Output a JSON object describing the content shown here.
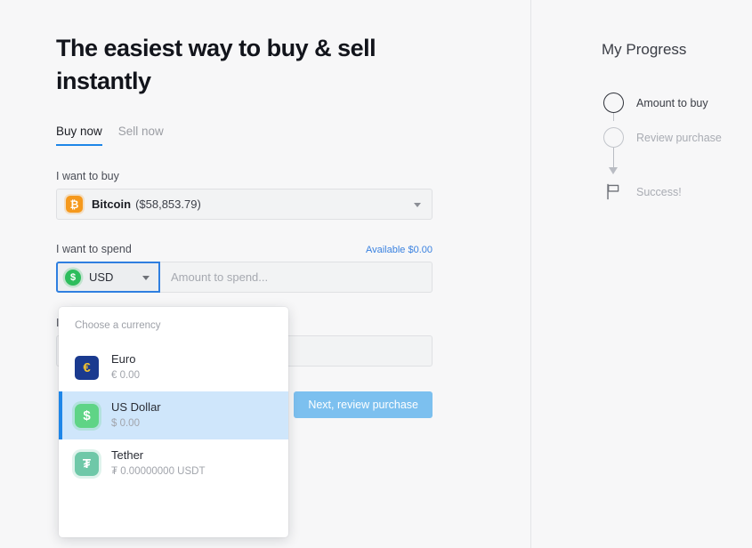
{
  "headline": "The easiest way to buy & sell instantly",
  "tabs": [
    {
      "label": "Buy now",
      "active": true
    },
    {
      "label": "Sell now",
      "active": false
    }
  ],
  "buy_section": {
    "label": "I want to buy",
    "asset": {
      "icon": "bitcoin-icon",
      "symbol": "₿",
      "name": "Bitcoin",
      "price": "($58,853.79)"
    }
  },
  "spend_section": {
    "label": "I want to spend",
    "available_label": "Available $0.00",
    "currency_button": {
      "icon": "usd-coin-icon",
      "symbol": "$",
      "label": "USD"
    },
    "amount_placeholder": "Amount to spend...",
    "amount_value": ""
  },
  "receive_section": {
    "label": "I want to receive",
    "value": ""
  },
  "currency_dropdown": {
    "title": "Choose a currency",
    "items": [
      {
        "icon": "euro-icon",
        "symbol": "€",
        "name": "Euro",
        "balance": "€ 0.00",
        "selected": false
      },
      {
        "icon": "usd-coin-icon",
        "symbol": "$",
        "name": "US Dollar",
        "balance": "$ 0.00",
        "selected": true
      },
      {
        "icon": "tether-icon",
        "symbol": "₮",
        "name": "Tether",
        "balance": "₮ 0.00000000 USDT",
        "selected": false
      }
    ]
  },
  "submit_button": {
    "label": "Next, review purchase",
    "enabled": false
  },
  "progress": {
    "title": "My Progress",
    "steps": [
      {
        "label": "Amount to buy",
        "marker": "circle",
        "state": "active"
      },
      {
        "label": "Review purchase",
        "marker": "circle",
        "state": "pending"
      },
      {
        "label": "Success!",
        "marker": "flag-icon",
        "state": "pending"
      }
    ]
  },
  "colors": {
    "accent_blue": "#1e86e8",
    "button_blue": "#7cc0ef",
    "bitcoin_orange": "#f5991d",
    "usd_green": "#2dbd5c",
    "tether_teal": "#6fc8a8",
    "euro_navy": "#1a3a8f",
    "page_bg": "#f7f7f8"
  }
}
